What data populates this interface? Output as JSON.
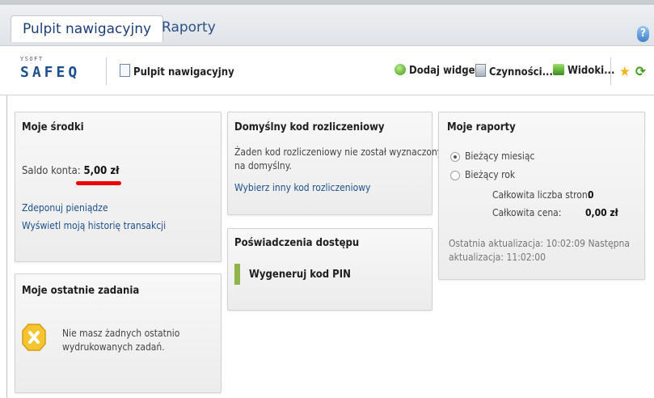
{
  "tabs": [
    {
      "label": "Pulpit nawigacyjny",
      "active": true
    },
    {
      "label": "Raporty",
      "active": false
    }
  ],
  "help_icon": "?",
  "toolbar": {
    "logo_small": "YSOFT",
    "logo_main": "SAFEQ",
    "page_link": "Pulpit nawigacyjny",
    "add_widget": "Dodaj widget",
    "actions": "Czynności...",
    "views": "Widoki..."
  },
  "funds": {
    "title": "Moje środki",
    "saldo_label": "Saldo konta:",
    "saldo_value": "5,00 zł",
    "deposit_link": "Zdeponuj pieniądze",
    "history_link": "Wyświetl moją historię transakcji"
  },
  "jobs": {
    "title": "Moje ostatnie zadania",
    "message_line1": "Nie masz żadnych ostatnio",
    "message_line2": "wydrukowanych zadań."
  },
  "billing": {
    "title": "Domyślny kod rozliczeniowy",
    "message_line1": "Żaden kod rozliczeniowy nie został wyznaczony",
    "message_line2": "na domyślny.",
    "choose_link": "Wybierz inny kod rozliczeniowy"
  },
  "credentials": {
    "title": "Poświadczenia dostępu",
    "generate_pin": "Wygeneruj kod PIN"
  },
  "reports": {
    "title": "Moje raporty",
    "option_month": "Bieżący miesiąc",
    "option_year": "Bieżący rok",
    "selected": "Bieżący miesiąc",
    "pages_label": "Całkowita liczba stron:",
    "pages_value": "0",
    "price_label": "Całkowita cena:",
    "price_value": "0,00 zł",
    "update_line1": "Ostatnia aktualizacja: 10:02:09  Następna",
    "update_line2": "aktualizacja: 11:02:00"
  },
  "colors": {
    "link": "#1c4f8d",
    "highlight_underline": "#ee0000",
    "pin_bar": "#8db54a"
  }
}
